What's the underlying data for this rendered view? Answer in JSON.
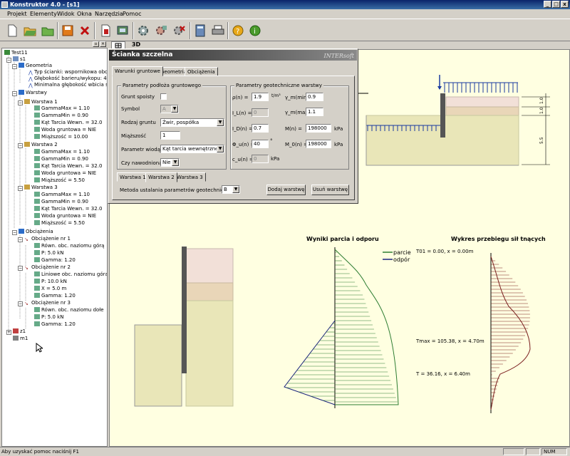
{
  "window": {
    "title": "Konstruktor 4.0 - [s1]",
    "min": "_",
    "max": "□",
    "close": "x"
  },
  "menu": [
    "Projekt",
    "Elementy",
    "Widok",
    "Okna",
    "Narzędzia",
    "Pomoc"
  ],
  "toolbar_icons": [
    "new-icon",
    "open-icon",
    "open-folder-icon",
    "save-icon",
    "delete-icon",
    "export-icon",
    "print-preview-icon",
    "settings-gear-icon",
    "copy-gear-icon",
    "delete-gear-icon",
    "calculator-icon",
    "printer-icon",
    "help-icon",
    "info-icon"
  ],
  "view_tabs": [
    "",
    "3D"
  ],
  "tree": {
    "root": "Test11",
    "s1": "s1",
    "geometria": "Geometria",
    "geo_items": [
      "Typ ścianki: wspornikowa obc",
      "Głębokość barieru/wykopu: 4",
      "Minimalna głębokość wbicia ś"
    ],
    "warstwy": "Warstwy",
    "layers": [
      {
        "name": "Warstwa 1",
        "items": [
          "GammaMax = 1.10",
          "GammaMin = 0.90",
          "Kąt Tarcia Wewn. = 32.0",
          "Woda gruntowa = NIE",
          "Miąższość = 10.00"
        ]
      },
      {
        "name": "Warstwa 2",
        "items": [
          "GammaMax = 1.10",
          "GammaMin = 0.90",
          "Kąt Tarcia Wewn. = 32.0",
          "Woda gruntowa = NIE",
          "Miąższość = 5.50"
        ]
      },
      {
        "name": "Warstwa 3",
        "items": [
          "GammaMax = 1.10",
          "GammaMin = 0.90",
          "Kąt Tarcia Wewn. = 32.0",
          "Woda gruntowa = NIE",
          "Miąższość = 5.50"
        ]
      }
    ],
    "obciazenia": "Obciążenia",
    "loads": [
      {
        "name": "Obciążenie nr 1",
        "items": [
          "Równ. obc. naziomu górą",
          "P: 5.0 kN",
          "Gamma: 1.20"
        ]
      },
      {
        "name": "Obciążenie nr 2",
        "items": [
          "Liniowe obc. naziomu góra",
          "P: 10.0 kN",
          "X = 5.0 m",
          "Gamma: 1.20"
        ]
      },
      {
        "name": "Obciążenie nr 3",
        "items": [
          "Równ. obc. naziomu dołe",
          "P: 5.0 kN",
          "Gamma: 1.20"
        ]
      }
    ],
    "z1": "z1",
    "m1": "m1"
  },
  "dialog": {
    "title": "Ścianka szczelna",
    "brand": "INTERsoft",
    "tabs": [
      "Warunki gruntowe",
      "Geometria",
      "Obciążenia"
    ],
    "group_left": "Parametry podłoża gruntowego",
    "group_right": "Parametry geotechniczne warstwy",
    "grunt_spoisty": "Grunt spoisty",
    "symbol_label": "Symbol",
    "symbol_value": "A",
    "rodzaj_label": "Rodzaj gruntu",
    "rodzaj_value": "Żwir, pospółka",
    "miazszosc_label": "Miąższość",
    "miazszosc_value": "1",
    "param_label": "Parametr wiodący",
    "param_value": "Kąt tarcia wewnętrznego",
    "nawodnienie_label": "Czy nawodniona",
    "nawodnienie_value": "Nie",
    "params": {
      "rho_label": "ρ(n) =",
      "rho_value": "1.9",
      "rho_unit": "t/m³",
      "il_label": "I_L(n) =",
      "il_value": "0",
      "id_label": "I_D(n) =",
      "id_value": "0.7",
      "phi_label": "Φ_u(n) =",
      "phi_value": "40",
      "phi_unit": "°",
      "cu_label": "c_u(n) =",
      "cu_value": "0",
      "cu_unit": "kPa",
      "gmin_label": "γ_m(min) =",
      "gmin_value": "0.9",
      "gmax_label": "γ_m(max) =",
      "gmax_value": "1.1",
      "m_label": "M(n) =",
      "m_value": "198000",
      "m_unit": "kPa",
      "m0_label": "M_0(n) =",
      "m0_value": "198000",
      "m0_unit": "kPa"
    },
    "layer_tabs": [
      "Warstwa 1",
      "Warstwa 2",
      "Warstwa 3"
    ],
    "metoda_label": "Metoda ustalania parametrów geotechnicznych",
    "metoda_value": "B",
    "add_button": "Dodaj warstwę",
    "remove_button": "Usuń warstwę"
  },
  "canvas": {
    "section_dims": [
      "1.0",
      "1.0",
      "5.5"
    ],
    "chart1_title": "Wyniki parcia i odporu",
    "legend": [
      "parcie",
      "odpór"
    ],
    "chart2_title": "Wykres przebiegu sił tnących",
    "annotations": [
      "T01 = 0.00, x = 0.00m",
      "Tmax = 105.38, x = 4.70m",
      "T = 36.16, x = 6.40m"
    ],
    "colors": {
      "parcie": "#2e7d32",
      "odpor": "#1a237e",
      "shear": "#7b1f1f",
      "soil1": "#f2e0d8",
      "soil2": "#e9d6b8",
      "soil3": "#e9e6b8"
    }
  },
  "status": {
    "hint": "Aby uzyskać pomoc naciśnij F1",
    "num": "NUM"
  }
}
